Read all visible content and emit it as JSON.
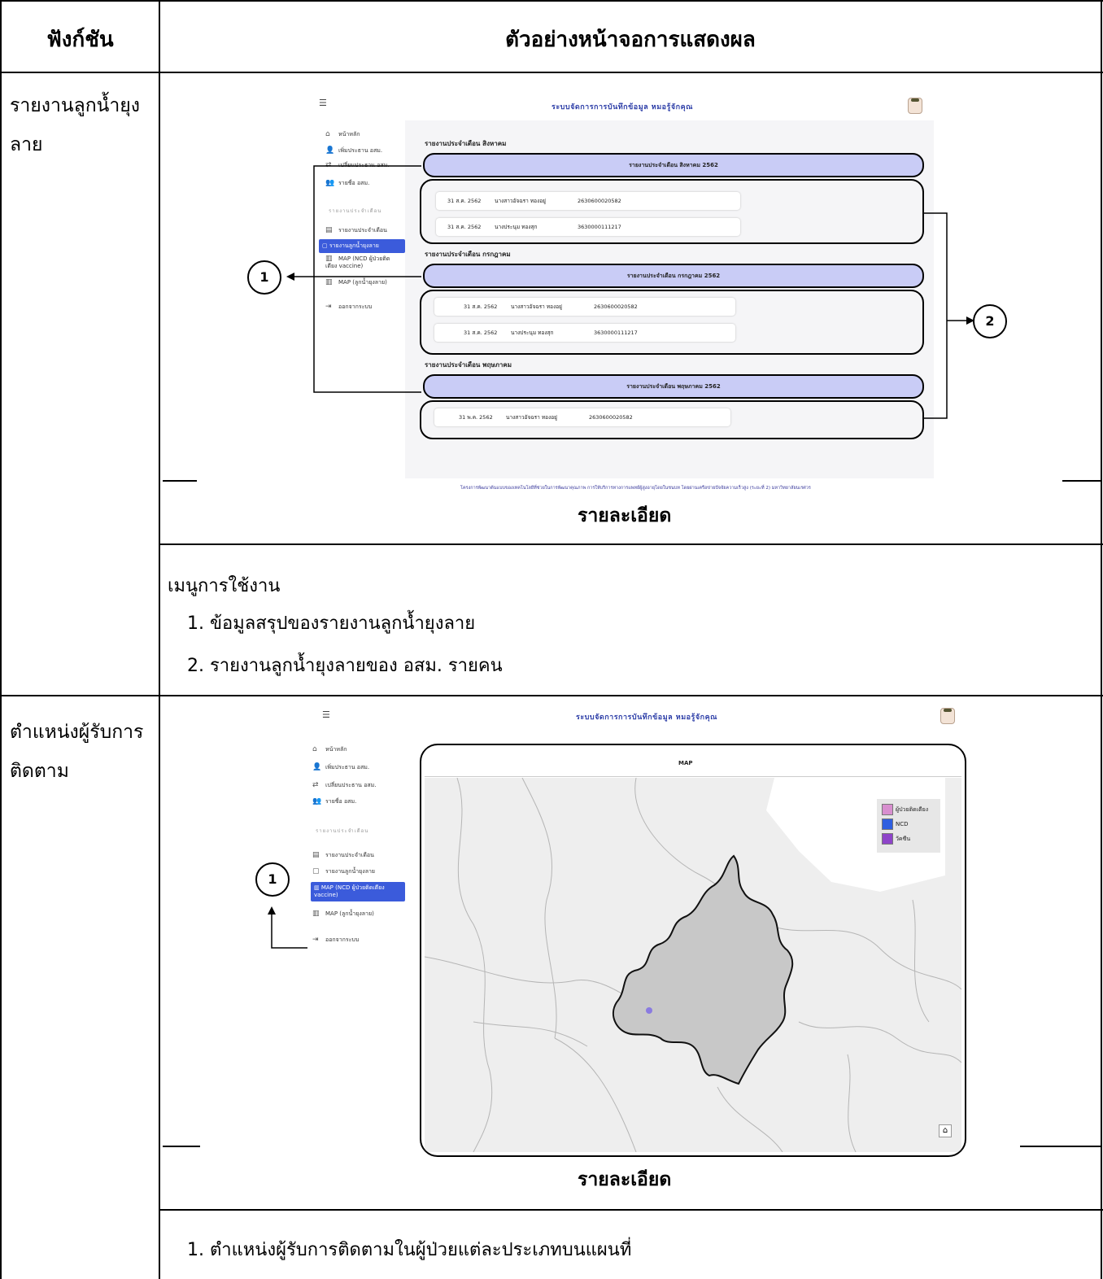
{
  "table": {
    "header_function": "ฟังก์ชัน",
    "header_example": "ตัวอย่างหน้าจอการแสดงผล",
    "rows": [
      {
        "function": "รายงานลูกน้ำยุงลาย",
        "detail_label": "รายละเอียด",
        "menu_title": "เมนูการใช้งาน",
        "menu_items": [
          "1. ข้อมูลสรุปของรายงานลูกน้ำยุงลาย",
          "2. รายงานลูกน้ำยุงลายของ อสม. รายคน"
        ]
      },
      {
        "function": "ตำแหน่งผู้รับการติดตาม",
        "detail_label": "รายละเอียด",
        "menu_items": [
          "1. ตำแหน่งผู้รับการติดตามในผู้ป่วยแต่ละประเภทบนแผนที่"
        ]
      }
    ]
  },
  "app": {
    "title": "ระบบจัดการการบันทึกข้อมูล หมอรู้จักคุณ",
    "sidebar": {
      "home": "หน้าหลัก",
      "add_osm": "เพิ่มประธาน อสม.",
      "change_osm": "เปลี่ยนประธาน อสม.",
      "osm_list": "รายชื่อ อสม.",
      "section_monthly": "รายงานประจำเดือน",
      "monthly_report": "รายงานประจำเดือน",
      "larvae_report": "รายงานลูกน้ำยุงลาย",
      "map_ncd": "MAP (NCD ผู้ป่วยติดเตียง vaccine)",
      "map_larvae": "MAP (ลูกน้ำยุงลาย)",
      "logout": "ออกจากระบบ"
    },
    "footer": "โครงการพัฒนาต้นแบบของเทคโนโลยีที่ช่วยในการพัฒนาคุณภาพ การให้บริการทางการแพทย์ผู้สูงอายุโดยในชนบท โดยผ่านเครือข่ายปัจจัยความเร็วสูง (ระยะที่ 2) มหาวิทยาลัยนเรศวร"
  },
  "report": {
    "months": [
      {
        "heading": "รายงานประจำเดือน สิงหาคม",
        "bar": "รายงานประจำเดือน สิงหาคม 2562",
        "rows": [
          {
            "date": "31 ส.ค. 2562",
            "name": "นางสาวอัจฉรา ทองอยู่",
            "id": "2630600020582"
          },
          {
            "date": "31 ส.ค. 2562",
            "name": "นางประนุม ทองสุก",
            "id": "3630000111217"
          }
        ]
      },
      {
        "heading": "รายงานประจำเดือน กรกฎาคม",
        "bar": "รายงานประจำเดือน กรกฎาคม 2562",
        "rows": [
          {
            "date": "31 ส.ค. 2562",
            "name": "นางสาวอัจฉรา ทองอยู่",
            "id": "2630600020582"
          },
          {
            "date": "31 ส.ค. 2562",
            "name": "นางประนุม ทองสุก",
            "id": "3630000111217"
          }
        ]
      },
      {
        "heading": "รายงานประจำเดือน พฤษภาคม",
        "bar": "รายงานประจำเดือน พฤษภาคม 2562",
        "rows": [
          {
            "date": "31 พ.ค. 2562",
            "name": "นางสาวอัจฉรา ทองอยู่",
            "id": "2630600020582"
          }
        ]
      }
    ]
  },
  "map": {
    "title": "MAP",
    "legend": [
      {
        "label": "ผู้ป่วยติดเตียง",
        "color": "#d88fcf"
      },
      {
        "label": "NCD",
        "color": "#2f5fe0"
      },
      {
        "label": "วัคซีน",
        "color": "#8e44c9"
      }
    ],
    "home_icon": "home-icon"
  },
  "callouts": {
    "one": "1",
    "two": "2"
  }
}
